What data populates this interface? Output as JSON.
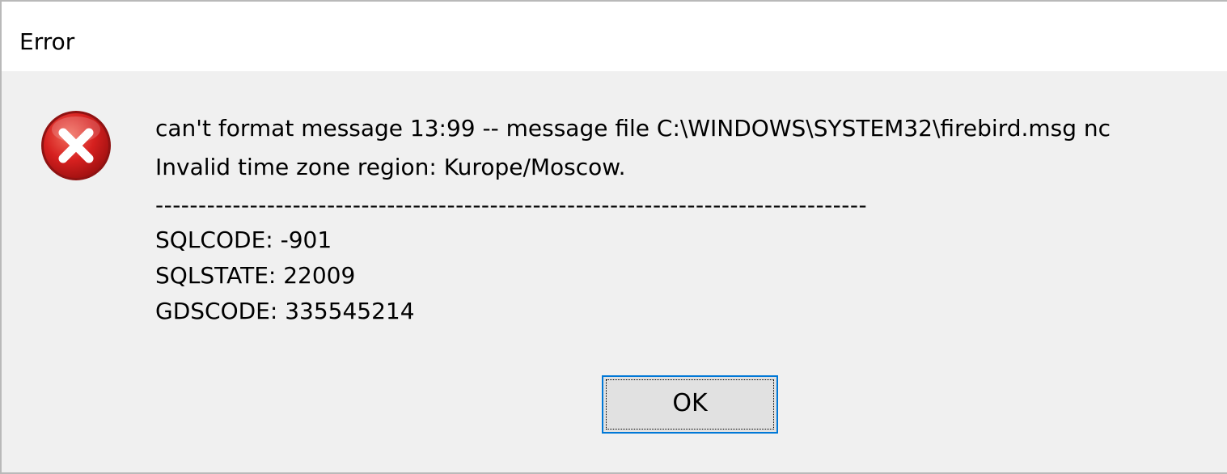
{
  "window": {
    "title": "Error"
  },
  "icon": {
    "name": "error-icon",
    "color": "#d6201f"
  },
  "message": {
    "line1": "can't format message 13:99 -- message file C:\\WINDOWS\\SYSTEM32\\firebird.msg nc",
    "line2": "Invalid time zone region: Kurope/Moscow.",
    "separator": "-----------------------------------------------------------------------------------",
    "sqlcode": "SQLCODE: -901",
    "sqlstate": "SQLSTATE: 22009",
    "gdscode": "GDSCODE: 335545214"
  },
  "buttons": {
    "ok_label": "OK"
  },
  "colors": {
    "focus_border": "#0078d7",
    "dialog_background": "#f0f0f0"
  }
}
